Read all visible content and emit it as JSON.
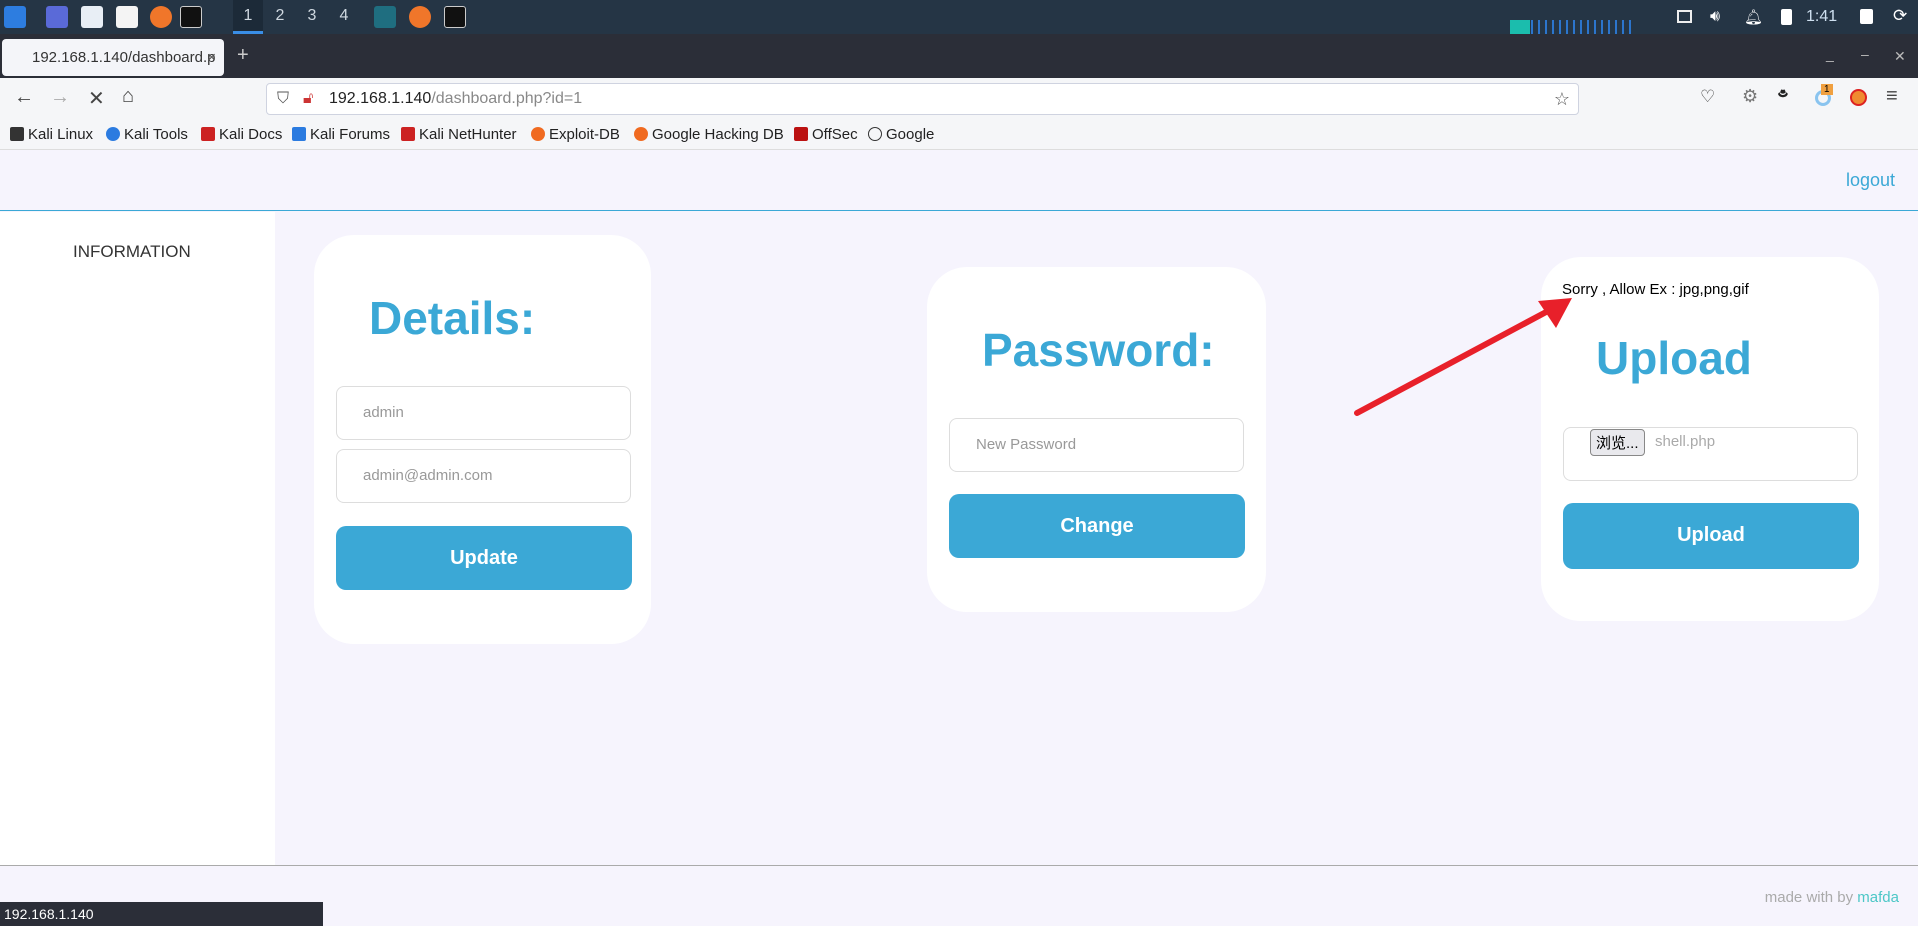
{
  "taskbar": {
    "workspaces": [
      "1",
      "2",
      "3",
      "4"
    ],
    "clock": "1:41"
  },
  "browser": {
    "tab_title": "192.168.1.140/dashboard.p",
    "url_host": "192.168.1.140",
    "url_path": "/dashboard.php?id=1",
    "bookmarks": [
      "Kali Linux",
      "Kali Tools",
      "Kali Docs",
      "Kali Forums",
      "Kali NetHunter",
      "Exploit-DB",
      "Google Hacking DB",
      "OffSec",
      "Google"
    ],
    "extension_badge": "1",
    "status_url": "192.168.1.140"
  },
  "page": {
    "logout": "logout",
    "sidebar_item": "INFORMATION",
    "details": {
      "title": "Details:",
      "username": "admin",
      "email": "admin@admin.com",
      "button": "Update"
    },
    "password": {
      "title": "Password:",
      "placeholder": "New Password",
      "button": "Change"
    },
    "upload": {
      "error": "Sorry , Allow Ex : jpg,png,gif",
      "title": "Upload",
      "browse": "浏览...",
      "file": "shell.php",
      "button": "Upload"
    },
    "footer_prefix": "made with by",
    "footer_author": "mafda"
  },
  "colors": {
    "accent": "#3ba8d6",
    "arrow": "#e8202a"
  }
}
